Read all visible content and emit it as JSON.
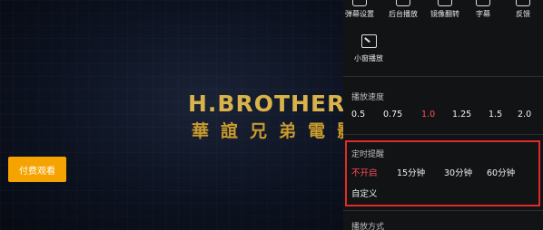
{
  "video": {
    "logo_en": "H.BROTHERS",
    "logo_cn": "華誼兄弟電影",
    "pay_button": "付费观看"
  },
  "panel": {
    "top_items": [
      {
        "label": "弹幕设置",
        "icon": "danmaku-settings-icon"
      },
      {
        "label": "后台播放",
        "icon": "background-play-icon"
      },
      {
        "label": "镜像翻转",
        "icon": "mirror-flip-icon"
      },
      {
        "label": "字幕",
        "icon": "subtitle-icon"
      },
      {
        "label": "反馈",
        "icon": "feedback-icon"
      }
    ],
    "mini_window": {
      "label": "小窗播放",
      "icon": "picture-in-picture-icon"
    },
    "speed": {
      "title": "播放速度",
      "options": [
        "0.5",
        "0.75",
        "1.0",
        "1.25",
        "1.5",
        "2.0"
      ],
      "selected": "1.0"
    },
    "timer": {
      "title": "定时提醒",
      "options": [
        "不开启",
        "15分钟",
        "30分钟",
        "60分钟"
      ],
      "selected": "不开启",
      "custom": "自定义"
    },
    "play_mode": {
      "title": "播放方式"
    }
  },
  "colors": {
    "accent": "#ff4d5a",
    "pay_button": "#f5a300",
    "highlight_border": "#e02b2b"
  }
}
